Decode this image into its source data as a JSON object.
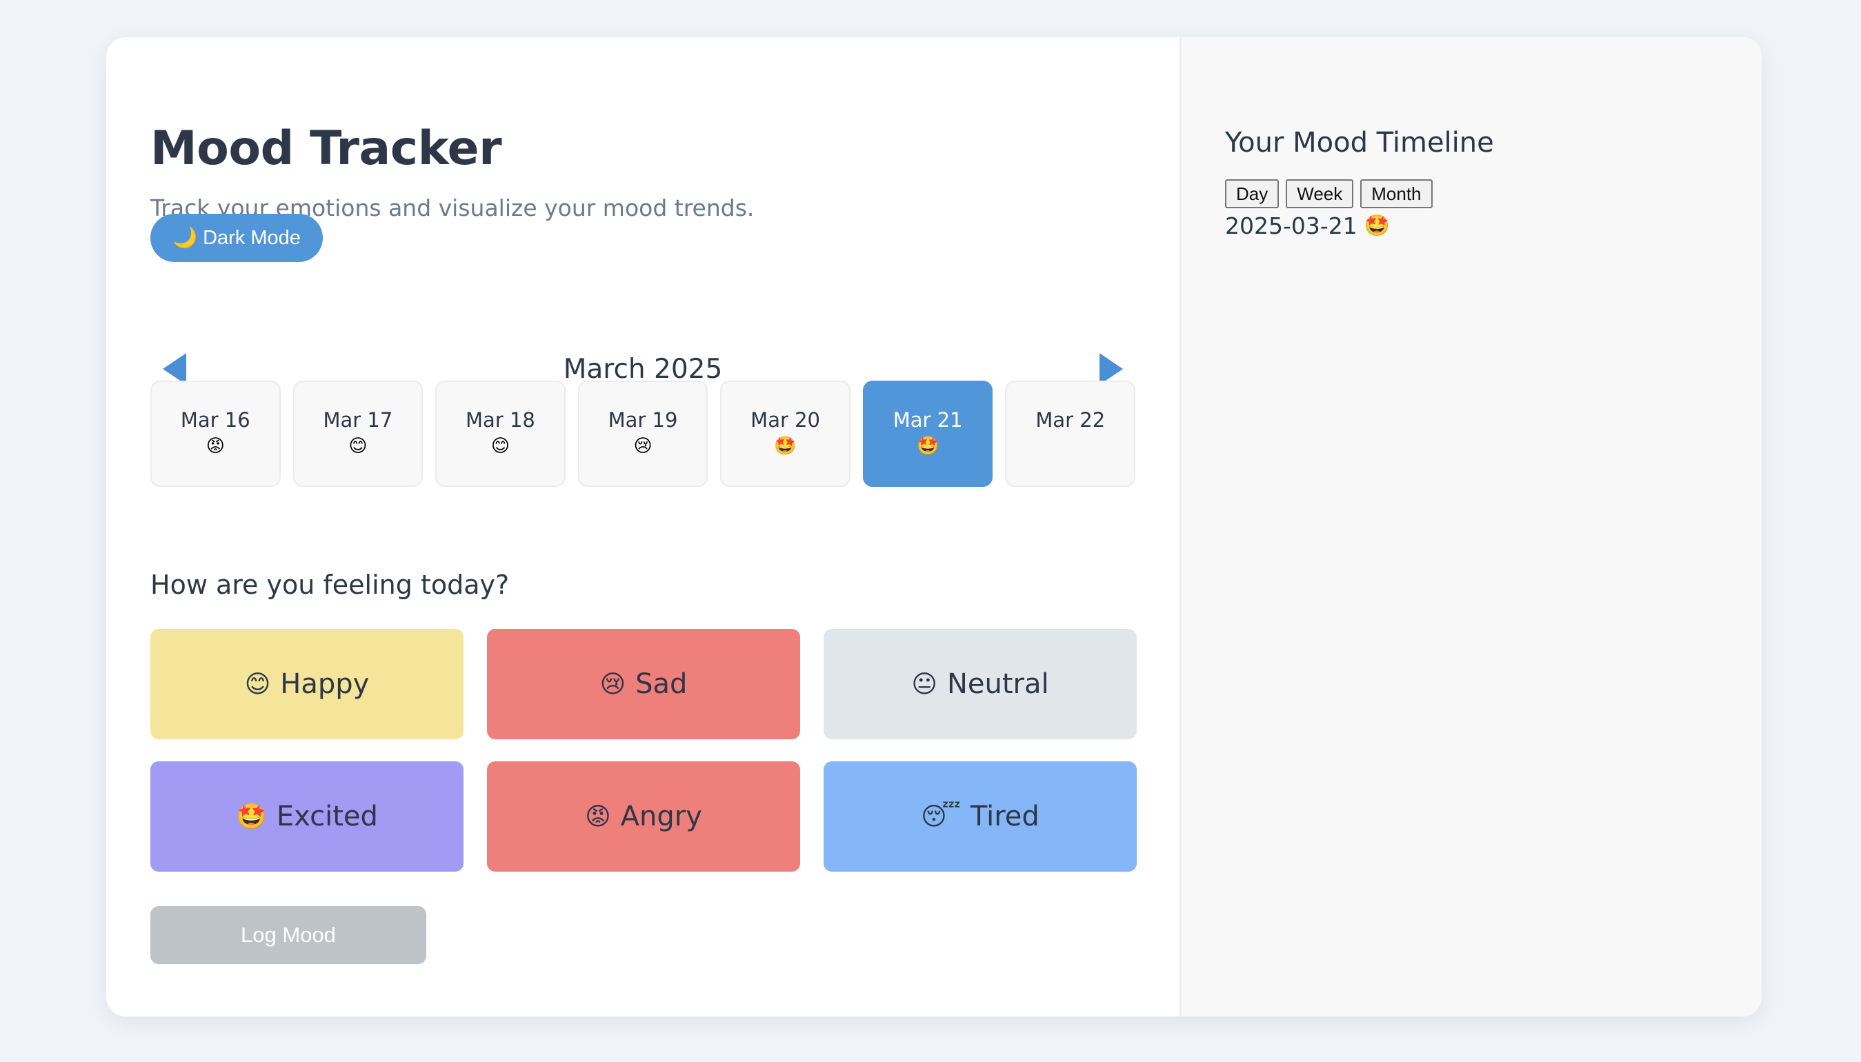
{
  "header": {
    "title": "Mood Tracker",
    "subtitle": "Track your emotions and visualize your mood trends.",
    "dark_mode_icon": "🌙",
    "dark_mode_label": "Dark Mode"
  },
  "calendar": {
    "month_label": "March 2025",
    "prev_icon": "left-triangle",
    "next_icon": "right-triangle",
    "days": [
      {
        "label": "Mar 16",
        "emoji": "😡",
        "active": false
      },
      {
        "label": "Mar 17",
        "emoji": "😊",
        "active": false
      },
      {
        "label": "Mar 18",
        "emoji": "😊",
        "active": false
      },
      {
        "label": "Mar 19",
        "emoji": "😢",
        "active": false
      },
      {
        "label": "Mar 20",
        "emoji": "🤩",
        "active": false
      },
      {
        "label": "Mar 21",
        "emoji": "🤩",
        "active": true
      },
      {
        "label": "Mar 22",
        "emoji": "",
        "active": false
      }
    ]
  },
  "mood_picker": {
    "question": "How are you feeling today?",
    "moods": [
      {
        "emoji": "😊",
        "label": "Happy",
        "color": "#f4e59b"
      },
      {
        "emoji": "😢",
        "label": "Sad",
        "color": "#ef7f7b"
      },
      {
        "emoji": "😐",
        "label": "Neutral",
        "color": "#e1e6eb"
      },
      {
        "emoji": "🤩",
        "label": "Excited",
        "color": "#a29bf4"
      },
      {
        "emoji": "😡",
        "label": "Angry",
        "color": "#ef7f7b"
      },
      {
        "emoji": "😴",
        "label": "Tired",
        "color": "#85b7f8"
      }
    ],
    "log_button": "Log Mood"
  },
  "timeline": {
    "title": "Your Mood Timeline",
    "views": [
      "Day",
      "Week",
      "Month"
    ],
    "entries": [
      {
        "date": "2025-03-21",
        "emoji": "🤩"
      }
    ]
  },
  "colors": {
    "accent": "#5196d8",
    "background": "#f0f3f8",
    "text": "#2d3748",
    "muted_text": "#6b7a8c",
    "disabled_button": "#bec3c8"
  }
}
